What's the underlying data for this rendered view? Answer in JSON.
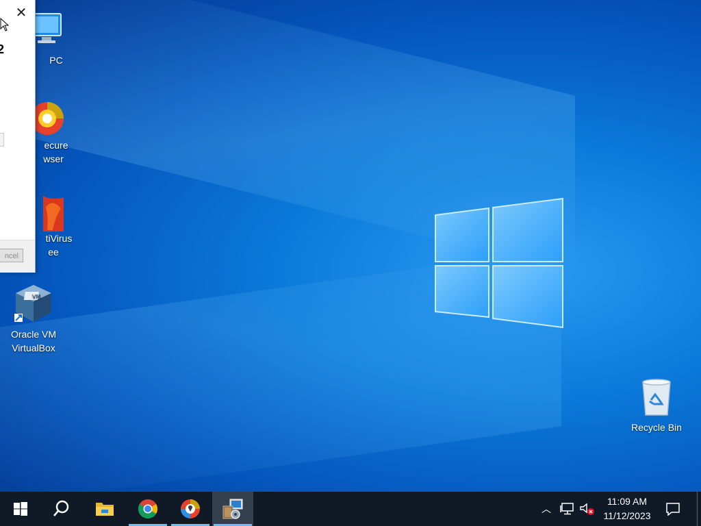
{
  "desktop": {
    "icons": [
      {
        "label": "PC"
      },
      {
        "label_line1": "ecure",
        "label_line2": "wser"
      },
      {
        "label_line1": "tiVirus",
        "label_line2": "ee"
      },
      {
        "label_line1": "Oracle VM",
        "label_line2": "VirtualBox"
      },
      {
        "label": "Recycle Bin"
      }
    ]
  },
  "dialog": {
    "close_glyph": "✕",
    "title_fragment": "2",
    "cancel_fragment": "ncel"
  },
  "taskbar": {
    "apps": [
      {
        "icon": "windows-start-icon"
      },
      {
        "icon": "search-icon"
      },
      {
        "icon": "file-explorer-icon"
      },
      {
        "icon": "chrome-icon"
      },
      {
        "icon": "secure-browser-icon"
      },
      {
        "icon": "setup-installer-icon"
      }
    ],
    "tray": {
      "chevron_glyph": "︿",
      "time": "11:09 AM",
      "date": "11/12/2023"
    }
  },
  "colors": {
    "accent": "#76b9ed",
    "taskbar": "#101a26",
    "desktop_blue": "#0a78d8"
  }
}
